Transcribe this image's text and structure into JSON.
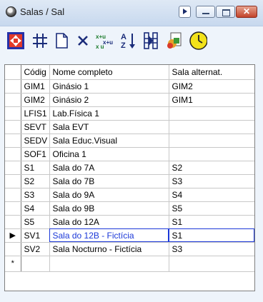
{
  "window": {
    "title": "Salas / Sal"
  },
  "toolbar": {
    "icons": [
      "navigate-icon",
      "grid-icon",
      "new-record-icon",
      "delete-icon",
      "replace-icon",
      "sort-az-icon",
      "filter-icon",
      "report-icon",
      "clock-icon"
    ]
  },
  "table": {
    "headers": [
      "Códig",
      "Nome completo",
      "Sala alternat."
    ],
    "rows": [
      {
        "code": "GIM1",
        "name": "Ginásio 1",
        "alt": "GIM2",
        "indicator": ""
      },
      {
        "code": "GIM2",
        "name": "Ginásio 2",
        "alt": "GIM1",
        "indicator": ""
      },
      {
        "code": "LFIS1",
        "name": "Lab.Física 1",
        "alt": "",
        "indicator": ""
      },
      {
        "code": "SEVT",
        "name": "Sala EVT",
        "alt": "",
        "indicator": ""
      },
      {
        "code": "SEDV",
        "name": "Sala Educ.Visual",
        "alt": "",
        "indicator": ""
      },
      {
        "code": "SOF1",
        "name": "Oficina 1",
        "alt": "",
        "indicator": ""
      },
      {
        "code": "S1",
        "name": "Sala do 7A",
        "alt": "S2",
        "indicator": ""
      },
      {
        "code": "S2",
        "name": "Sala do 7B",
        "alt": "S3",
        "indicator": ""
      },
      {
        "code": "S3",
        "name": "Sala do 9A",
        "alt": "S4",
        "indicator": ""
      },
      {
        "code": "S4",
        "name": "Sala do 9B",
        "alt": "S5",
        "indicator": ""
      },
      {
        "code": "S5",
        "name": "Sala do 12A",
        "alt": "S1",
        "indicator": ""
      },
      {
        "code": "SV1",
        "name": "Sala do 12B - Fictícia",
        "alt": "S1",
        "indicator": "▶"
      },
      {
        "code": "SV2",
        "name": "Sala Nocturno - Fictícia",
        "alt": "S3",
        "indicator": ""
      }
    ],
    "new_row_indicator": "*"
  }
}
